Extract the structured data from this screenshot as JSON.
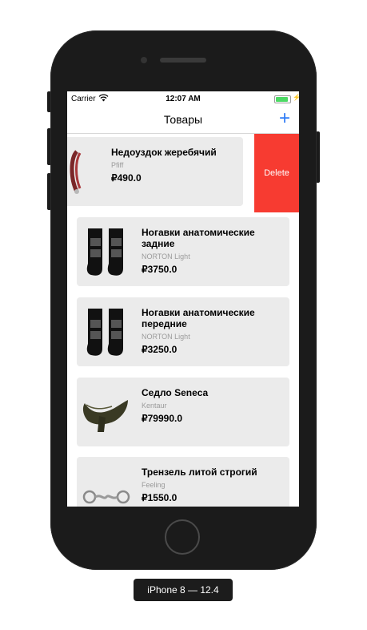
{
  "status_bar": {
    "carrier": "Carrier",
    "time": "12:07 AM",
    "battery_level": 0.9
  },
  "navbar": {
    "title": "Товары",
    "add_label": "+"
  },
  "products": [
    {
      "name": "Недоуздок жеребячий",
      "brand": "Pfiff",
      "price": "₽490.0",
      "image": "halter-icon"
    },
    {
      "name": "Ногавки анатомические задние",
      "brand": "NORTON Light",
      "price": "₽3750.0",
      "image": "boots-icon"
    },
    {
      "name": "Ногавки анатомические передние",
      "brand": "NORTON Light",
      "price": "₽3250.0",
      "image": "boots-icon"
    },
    {
      "name": "Седло Seneca",
      "brand": "Kentaur",
      "price": "₽79990.0",
      "image": "saddle-icon"
    },
    {
      "name": "Трензель литой строгий",
      "brand": "Feeling",
      "price": "₽1550.0",
      "image": "bit-icon"
    }
  ],
  "swipe_action": {
    "label": "Delete",
    "color": "#f73b31"
  },
  "device_label": "iPhone 8 — 12.4"
}
